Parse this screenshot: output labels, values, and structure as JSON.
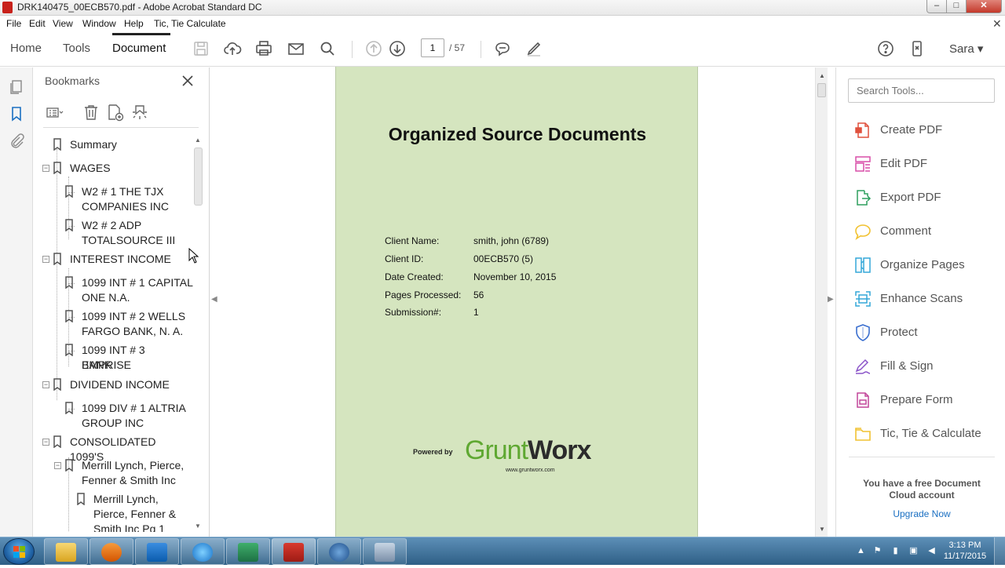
{
  "window": {
    "title": "DRK140475_00ECB570.pdf - Adobe Acrobat Standard DC",
    "controls": {
      "minimize": "–",
      "maximize": "□",
      "close": "✕"
    }
  },
  "menu": {
    "items": [
      "File",
      "Edit",
      "View",
      "Window",
      "Help",
      "Tic, Tie Calculate"
    ],
    "close_glyph": "✕"
  },
  "toolbar": {
    "tabs": [
      "Home",
      "Tools",
      "Document"
    ],
    "active_tab": "Document",
    "page_current": "1",
    "page_total": "/ 57",
    "user": "Sara ▾"
  },
  "bookmarks": {
    "title": "Bookmarks",
    "items": [
      {
        "label_lines": [
          "Summary"
        ]
      },
      {
        "label_lines": [
          "WAGES"
        ]
      },
      {
        "label_lines": [
          "W2 # 1 THE TJX",
          "COMPANIES INC"
        ]
      },
      {
        "label_lines": [
          "W2 # 2 ADP",
          "TOTALSOURCE III"
        ]
      },
      {
        "label_lines": [
          "INTEREST INCOME"
        ]
      },
      {
        "label_lines": [
          "1099 INT # 1 CAPITAL",
          "ONE N.A."
        ]
      },
      {
        "label_lines": [
          "1099 INT # 2 WELLS",
          "FARGO BANK, N. A."
        ]
      },
      {
        "label_lines": [
          "1099 INT # 3 EMPRISE",
          "BANK"
        ]
      },
      {
        "label_lines": [
          "DIVIDEND INCOME"
        ]
      },
      {
        "label_lines": [
          "1099 DIV # 1 ALTRIA",
          "GROUP INC"
        ]
      },
      {
        "label_lines": [
          "CONSOLIDATED 1099'S"
        ]
      },
      {
        "label_lines": [
          "Merrill Lynch, Pierce,",
          "Fenner & Smith Inc"
        ]
      },
      {
        "label_lines": [
          "Merrill Lynch,",
          "Pierce, Fenner &",
          "Smith Inc Pg 1"
        ]
      }
    ],
    "toggle_glyph": "−"
  },
  "document": {
    "title": "Organized Source Documents",
    "fields": [
      {
        "label": "Client Name:",
        "value": "smith, john (6789)"
      },
      {
        "label": "Client ID:",
        "value": "00ECB570 (5)"
      },
      {
        "label": "Date Created:",
        "value": "November 10, 2015"
      },
      {
        "label": "Pages Processed:",
        "value": "56"
      },
      {
        "label": "Submission#:",
        "value": "1"
      }
    ],
    "powered_by": "Powered by",
    "brand_part1": "Grunt",
    "brand_part2": "Worx",
    "brand_url": "www.gruntworx.com",
    "page_color": "#d5e5bf"
  },
  "tools_pane": {
    "search_placeholder": "Search Tools...",
    "tools": [
      {
        "label": "Create PDF",
        "icon": "create-pdf-icon",
        "color": "#e0513d"
      },
      {
        "label": "Edit PDF",
        "icon": "edit-pdf-icon",
        "color": "#d94fa8"
      },
      {
        "label": "Export PDF",
        "icon": "export-pdf-icon",
        "color": "#2e9f5e"
      },
      {
        "label": "Comment",
        "icon": "comment-icon",
        "color": "#f1c232"
      },
      {
        "label": "Organize Pages",
        "icon": "organize-pages-icon",
        "color": "#34a7d8"
      },
      {
        "label": "Enhance Scans",
        "icon": "enhance-scans-icon",
        "color": "#34a7d8"
      },
      {
        "label": "Protect",
        "icon": "protect-icon",
        "color": "#3b6fcf"
      },
      {
        "label": "Fill & Sign",
        "icon": "fill-sign-icon",
        "color": "#8b55c9"
      },
      {
        "label": "Prepare Form",
        "icon": "prepare-form-icon",
        "color": "#c2479a"
      },
      {
        "label": "Tic, Tie & Calculate",
        "icon": "tic-tie-calculate-icon",
        "color": "#f1c232"
      }
    ],
    "cloud_message": "You have a free Document Cloud account",
    "upgrade_link": "Upgrade Now"
  },
  "taskbar": {
    "time": "3:13 PM",
    "date": "11/17/2015",
    "apps": [
      "file-explorer-icon",
      "media-player-icon",
      "outlook-icon",
      "internet-explorer-icon",
      "excel-icon",
      "acrobat-icon",
      "drake-14-icon",
      "network-tool-icon"
    ]
  }
}
